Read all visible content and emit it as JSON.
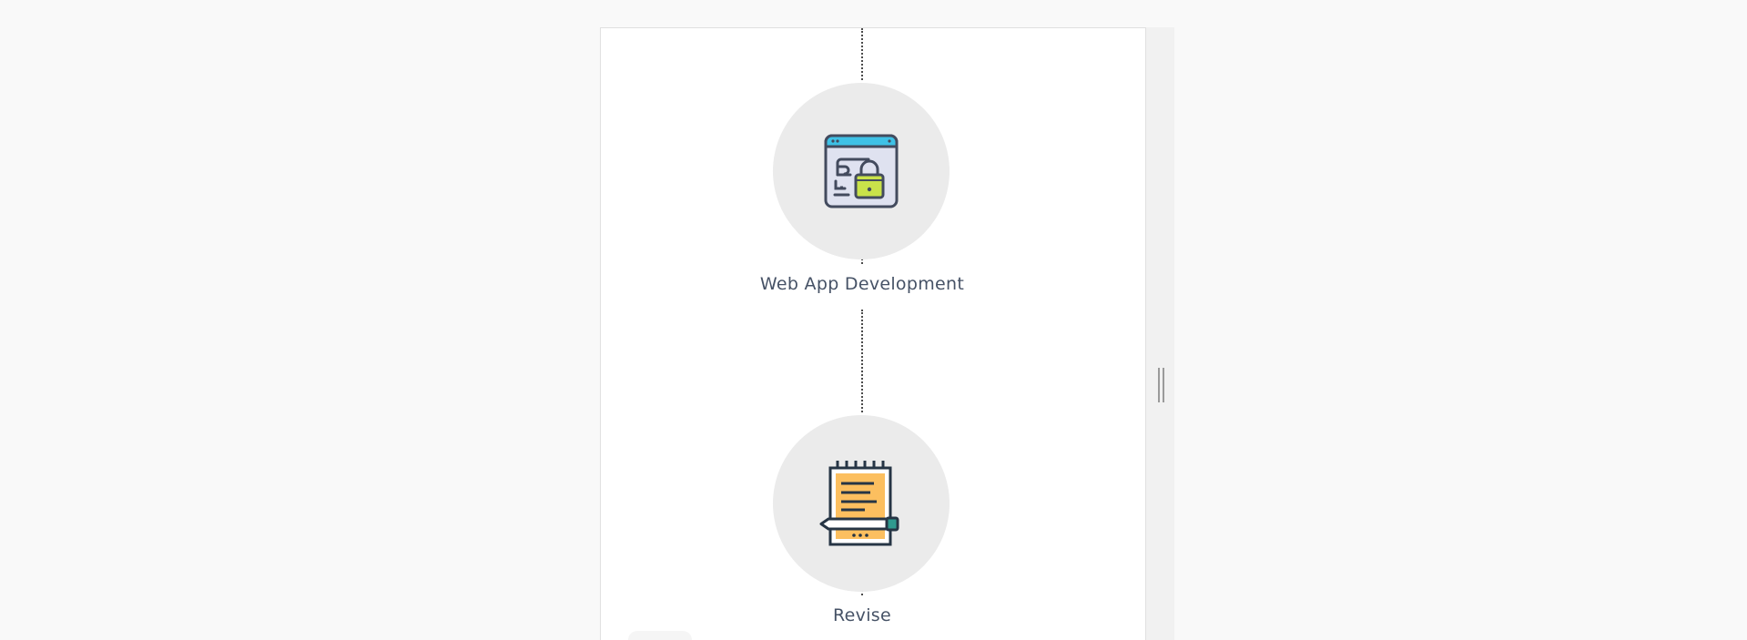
{
  "process_steps": [
    {
      "label": "Web App Development",
      "icon": "web-app-lock-icon"
    },
    {
      "label": "Revise",
      "icon": "notepad-pen-icon"
    }
  ],
  "colors": {
    "circle_bg": "#ebebeb",
    "label_text": "#465266",
    "icon_outline": "#434b5e",
    "browser_bar": "#3ec1e6",
    "lock_green": "#c9e24a",
    "notepad_orange": "#fcbf5f",
    "pen_teal": "#2f9a8f"
  }
}
